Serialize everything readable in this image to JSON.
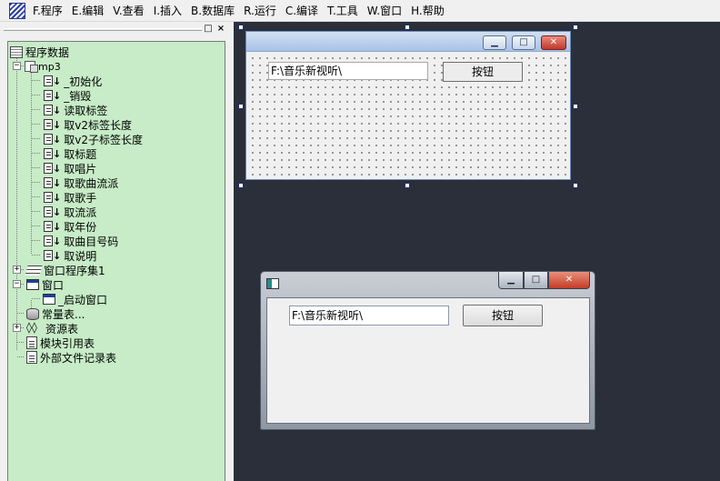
{
  "menu": [
    {
      "label": "F.程序"
    },
    {
      "label": "E.编辑"
    },
    {
      "label": "V.查看"
    },
    {
      "label": "I.插入"
    },
    {
      "label": "B.数据库"
    },
    {
      "label": "R.运行"
    },
    {
      "label": "C.编译"
    },
    {
      "label": "T.工具"
    },
    {
      "label": "W.窗口"
    },
    {
      "label": "H.帮助"
    }
  ],
  "panel": {
    "restore_glyph": "□",
    "close_glyph": "×"
  },
  "tree": {
    "expand_glyph": "+",
    "collapse_glyph": "−",
    "arrow_glyph": "↓",
    "root": {
      "label": "程序数据",
      "icon": "database-root-icon"
    },
    "module": {
      "label": "mp3",
      "icon": "module-icon"
    },
    "subs": [
      {
        "label": "_初始化"
      },
      {
        "label": "_销毁"
      },
      {
        "label": "读取标签"
      },
      {
        "label": "取v2标签长度"
      },
      {
        "label": "取v2子标签长度"
      },
      {
        "label": "取标题"
      },
      {
        "label": "取唱片"
      },
      {
        "label": "取歌曲流派"
      },
      {
        "label": "取歌手"
      },
      {
        "label": "取流派"
      },
      {
        "label": "取年份"
      },
      {
        "label": "取曲目号码"
      },
      {
        "label": "取说明"
      }
    ],
    "window_set": {
      "label": "窗口程序集1",
      "icon": "book-icon"
    },
    "windows": {
      "label": "窗口",
      "icon": "window-icon"
    },
    "startup_window": {
      "label": "_启动窗口",
      "icon": "window-icon"
    },
    "constants": {
      "label": "常量表...",
      "icon": "constants-icon"
    },
    "resources": {
      "label": "资源表",
      "icon": "resource-icon",
      "glyph": "◊◊"
    },
    "module_refs": {
      "label": "模块引用表",
      "icon": "module-ref-icon"
    },
    "external_files": {
      "label": "外部文件记录表",
      "icon": "file-list-icon"
    }
  },
  "design_form": {
    "input_value": "F:\\音乐新视听\\",
    "button_label": "按钮",
    "min_glyph": "▁",
    "max_glyph": "□",
    "close_glyph": "✕"
  },
  "preview_window": {
    "input_value": "F:\\音乐新视听\\",
    "button_label": "按钮",
    "min_glyph": "▁",
    "max_glyph": "□",
    "close_glyph": "✕"
  },
  "colors": {
    "tree_background": "#c7ecc7",
    "design_background": "#2b2f3a",
    "selection_handle": "#1e2f70"
  }
}
